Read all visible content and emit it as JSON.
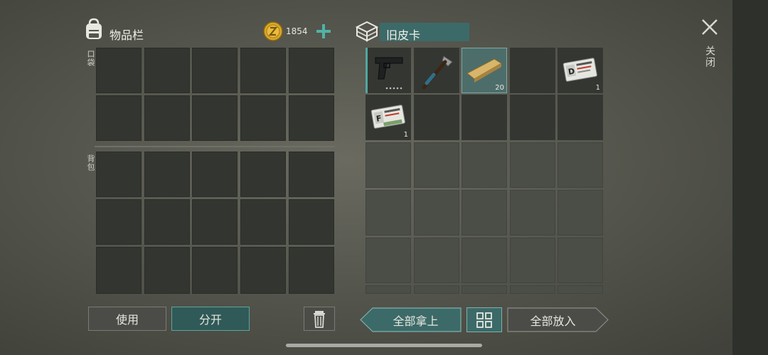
{
  "inventory": {
    "title": "物品栏",
    "coins": "1854",
    "pocket_label": "口袋",
    "backpack_label": "背包"
  },
  "container": {
    "title": "旧皮卡",
    "items": [
      {
        "icon": "pistol-icon",
        "qty": ""
      },
      {
        "icon": "hatchet-icon",
        "qty": ""
      },
      {
        "icon": "wood-plank-icon",
        "qty": "20"
      },
      {
        "icon": "",
        "qty": ""
      },
      {
        "icon": "id-card-d-icon",
        "qty": "1",
        "letter": "D"
      },
      {
        "icon": "id-card-f-icon",
        "qty": "1",
        "letter": "F"
      }
    ]
  },
  "close_label": "关闭",
  "buttons": {
    "use": "使用",
    "split": "分开",
    "take_all": "全部拿上",
    "put_all": "全部放入"
  },
  "colors": {
    "accent": "#3c6a68",
    "selected": "#4d6d6b",
    "coin": "#d9a72a"
  }
}
